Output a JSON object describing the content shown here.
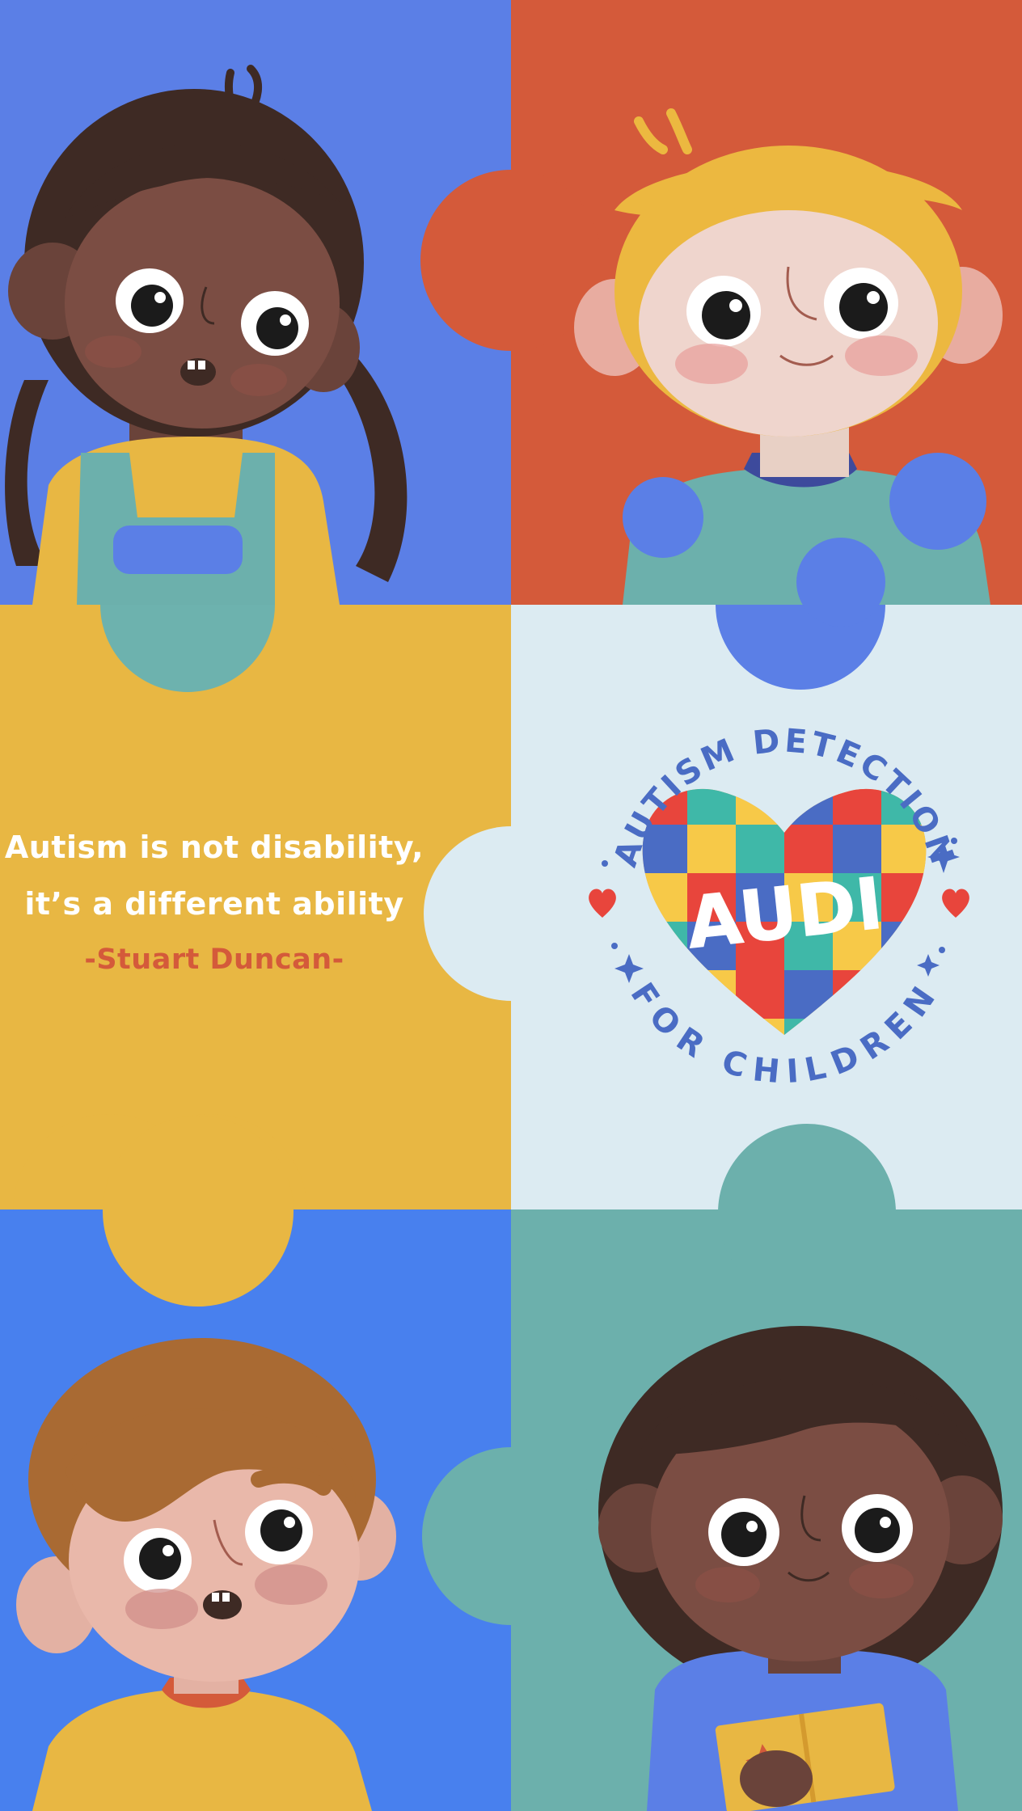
{
  "quote": {
    "line1": "Autism is not disability,",
    "line2": "it’s a different ability",
    "author": "-Stuart Duncan-"
  },
  "logo": {
    "top_text": "AUTISM DETECTION",
    "center_text": "AUDI",
    "bottom_text": "FOR CHILDREN"
  },
  "icons": {
    "heart": "heart-icon",
    "sparkle": "sparkle-icon",
    "puzzle_heart": "puzzle-heart-icon"
  },
  "colors": {
    "blue": "#5b7fe6",
    "orange_red": "#d45a3a",
    "yellow": "#e8b743",
    "light_blue": "#dcebf2",
    "bright_blue": "#4880ee",
    "teal": "#6cb0ac",
    "logo_blue": "#4a6cc4",
    "heart_red": "#e8453c"
  }
}
